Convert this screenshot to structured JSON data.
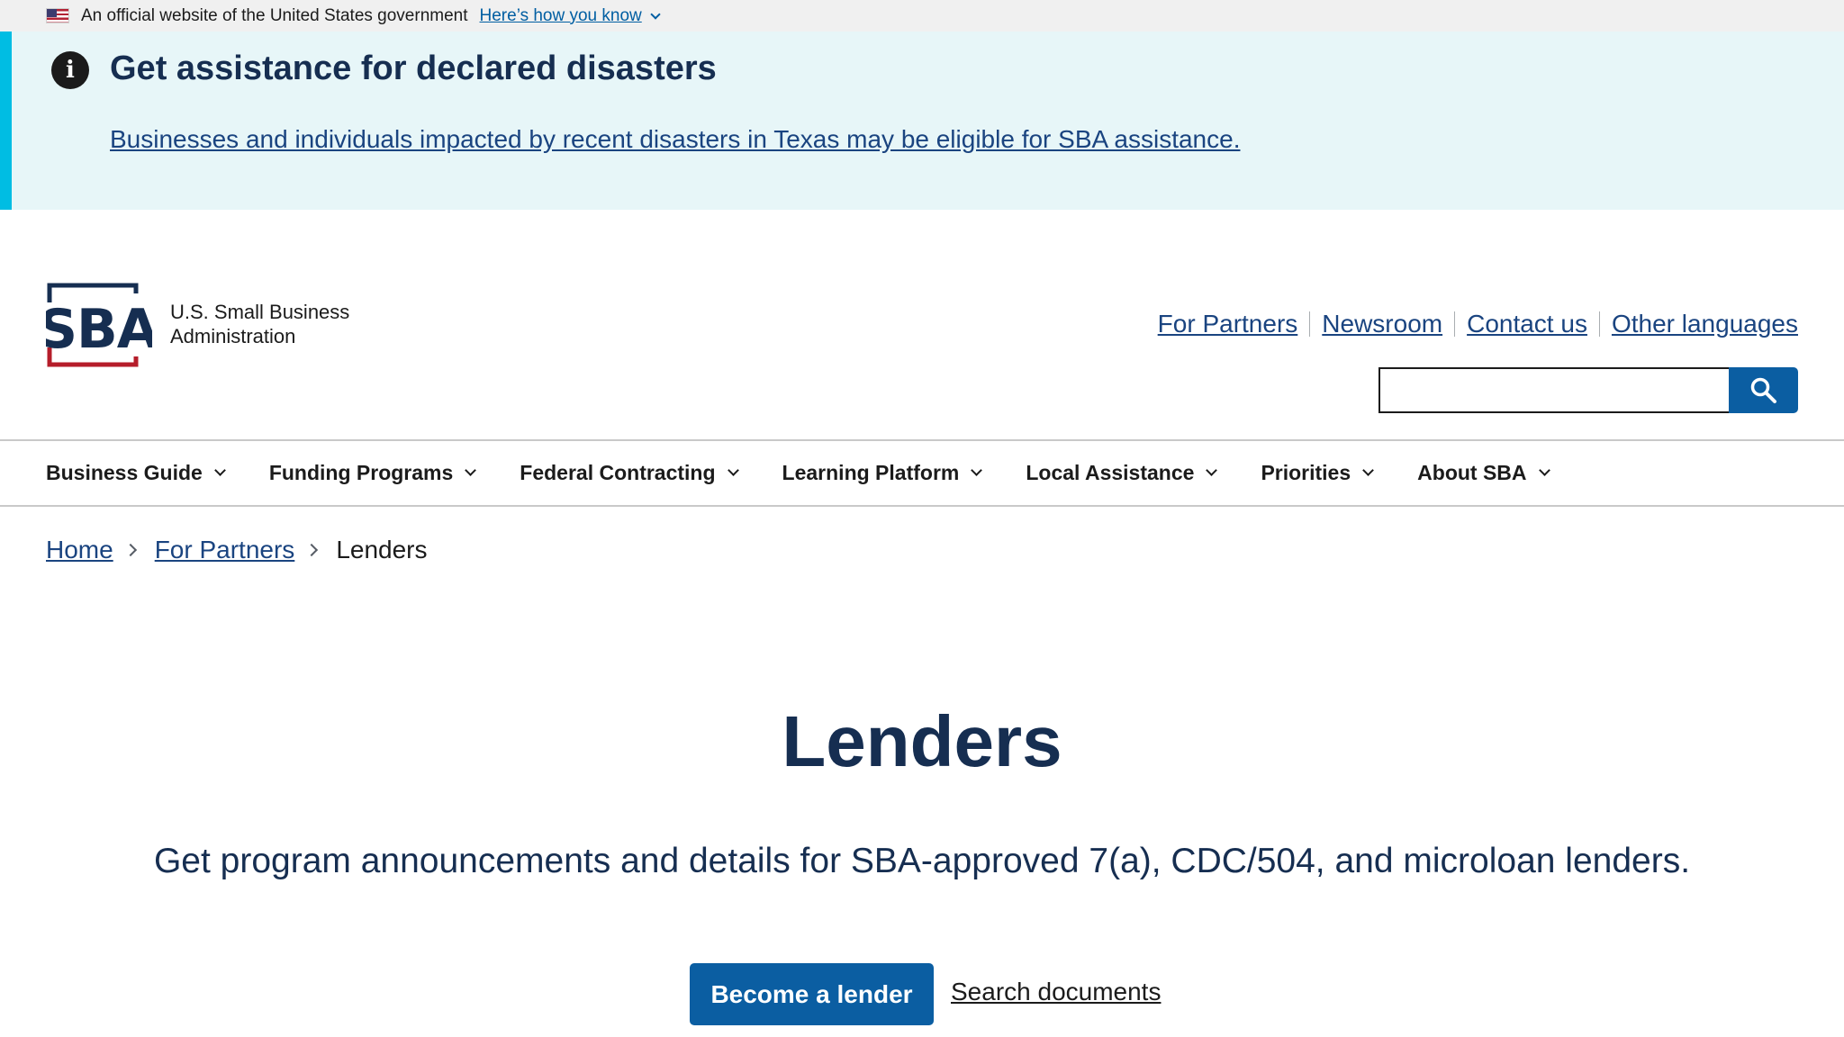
{
  "gov_banner": {
    "text": "An official website of the United States government",
    "how_link": "Here’s how you know",
    "flag_icon": "us-flag-icon"
  },
  "alert": {
    "icon": "info-icon",
    "icon_glyph": "i",
    "title": "Get assistance for declared disasters",
    "link": "Businesses and individuals impacted by recent disasters in Texas may be eligible for SBA assistance.",
    "accent_color": "#00bde3",
    "background_color": "#e7f6f8"
  },
  "header": {
    "logo_text": "SBA",
    "org_name_line1": "U.S. Small Business",
    "org_name_line2": "Administration",
    "utility_links": [
      "For Partners",
      "Newsroom",
      "Contact us",
      "Other languages"
    ],
    "search": {
      "placeholder": "",
      "icon": "search-icon"
    }
  },
  "nav": {
    "items": [
      "Business Guide",
      "Funding Programs",
      "Federal Contracting",
      "Learning Platform",
      "Local Assistance",
      "Priorities",
      "About SBA"
    ]
  },
  "breadcrumb": {
    "items": [
      "Home",
      "For Partners"
    ],
    "current": "Lenders"
  },
  "hero": {
    "title": "Lenders",
    "lead": "Get program announcements and details for SBA-approved 7(a), CDC/504, and microloan lenders.",
    "primary_button": "Become a lender",
    "secondary_link": "Search documents"
  },
  "colors": {
    "brand_navy": "#162e51",
    "primary_blue": "#0b5ea2",
    "link_blue": "#1a4480",
    "brand_red": "#b51d2a"
  }
}
